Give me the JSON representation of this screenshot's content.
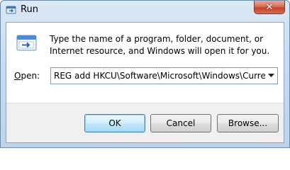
{
  "window": {
    "title": "Run",
    "close_glyph": "✕"
  },
  "dialog": {
    "message": "Type the name of a program, folder, document, or Internet resource, and Windows will open it for you.",
    "open_label_accel": "O",
    "open_label_rest": "pen:",
    "command_value": "REG add HKCU\\Software\\Microsoft\\Windows\\CurrentVe"
  },
  "buttons": {
    "ok": "OK",
    "cancel": "Cancel",
    "browse": "Browse..."
  },
  "icons": {
    "title": "run-icon",
    "large": "run-program-icon",
    "dropdown": "chevron-down-icon"
  }
}
